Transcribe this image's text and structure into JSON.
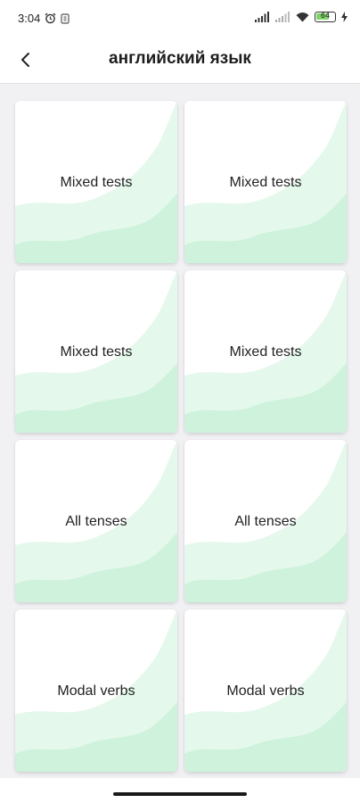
{
  "status_bar": {
    "time": "3:04",
    "battery": "64"
  },
  "header": {
    "title": "английский язык"
  },
  "cards": [
    {
      "label": "Mixed tests"
    },
    {
      "label": "Mixed tests"
    },
    {
      "label": "Mixed tests"
    },
    {
      "label": "Mixed tests"
    },
    {
      "label": "All tenses"
    },
    {
      "label": "All tenses"
    },
    {
      "label": "Modal verbs"
    },
    {
      "label": "Modal verbs"
    }
  ],
  "colors": {
    "accent_light": "#e5f8ec",
    "accent_mid": "#c8f0d8",
    "background": "#f1f1f4"
  }
}
